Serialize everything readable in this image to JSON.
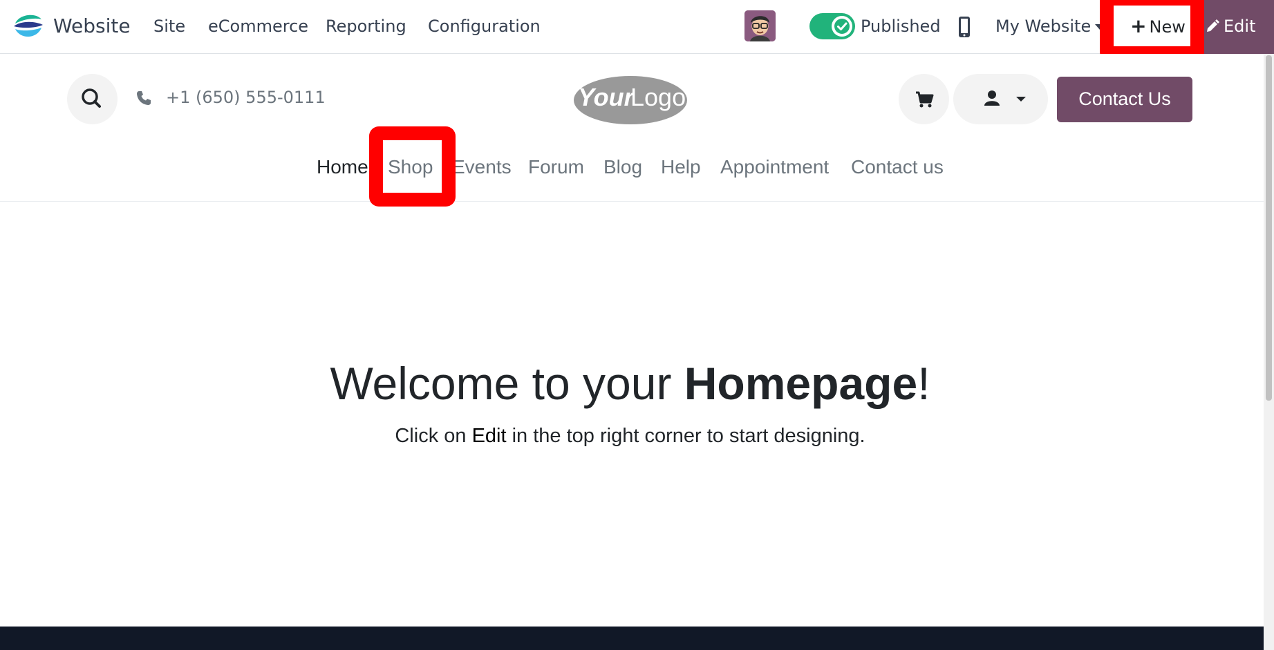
{
  "topbar": {
    "app_name": "Website",
    "menu": [
      "Site",
      "eCommerce",
      "Reporting",
      "Configuration"
    ],
    "published_label": "Published",
    "website_selector": "My Website",
    "new_label": "New",
    "edit_label": "Edit",
    "icons": [
      "website-app-icon",
      "avatar",
      "toggle",
      "mobile-icon",
      "plus-icon",
      "pencil-icon"
    ]
  },
  "header": {
    "phone": "+1 (650) 555-0111",
    "logo_text_bold": "Your",
    "logo_text_light": "Logo",
    "contact_button": "Contact Us",
    "nav": [
      "Home",
      "Shop",
      "Events",
      "Forum",
      "Blog",
      "Help",
      "Appointment",
      "Contact us"
    ],
    "active_nav": "Home"
  },
  "main": {
    "title_prefix": "Welcome to your ",
    "title_bold": "Homepage",
    "title_suffix": "!",
    "subtitle_prefix": "Click on ",
    "subtitle_em": "Edit",
    "subtitle_suffix": " in the top right corner to start designing."
  },
  "colors": {
    "brand": "#714b67",
    "toggle_on": "#21b37b",
    "highlight": "#ff0000",
    "footer": "#111827"
  }
}
